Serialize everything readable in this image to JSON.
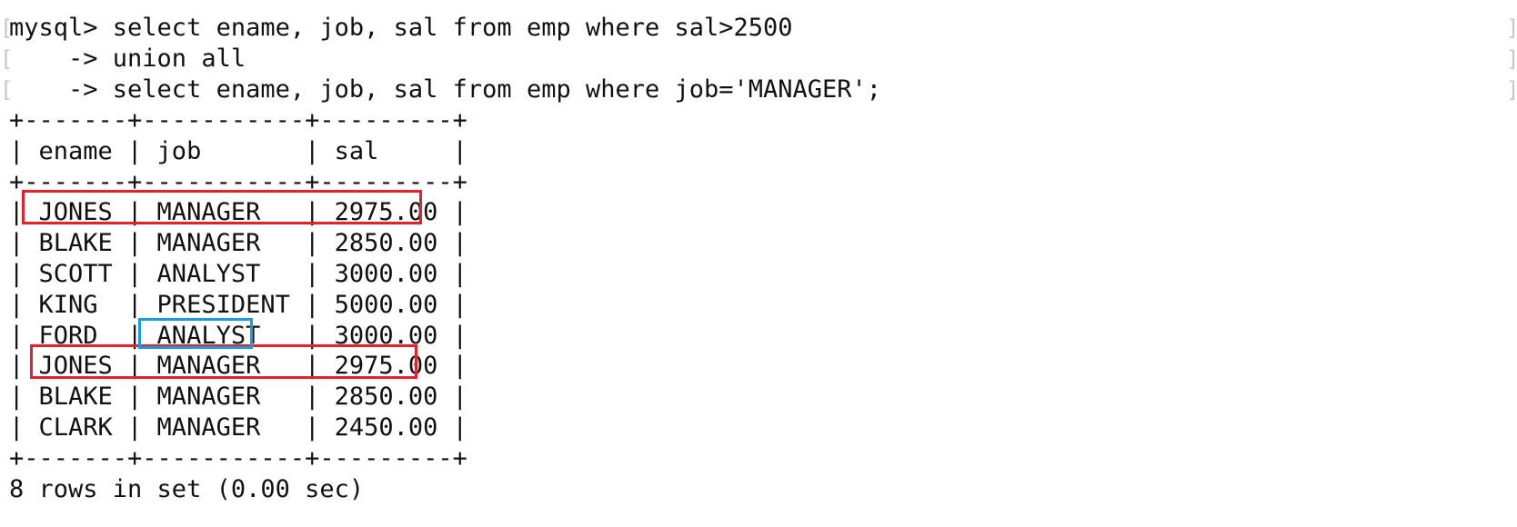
{
  "terminal": {
    "prompt_lines": [
      "mysql> select ename, job, sal from emp where sal>2500",
      "    -> union all",
      "    -> select ename, job, sal from emp where job='MANAGER';"
    ],
    "bracket_left": "[",
    "bracket_right": "]",
    "table": {
      "border": "+-------+-----------+---------+",
      "header": "| ename | job       | sal     |",
      "rows": [
        "| JONES | MANAGER   | 2975.00 |",
        "| BLAKE | MANAGER   | 2850.00 |",
        "| SCOTT | ANALYST   | 3000.00 |",
        "| KING  | PRESIDENT | 5000.00 |",
        "| FORD  | ANALYST   | 3000.00 |",
        "| JONES | MANAGER   | 2975.00 |",
        "| BLAKE | MANAGER   | 2850.00 |",
        "| CLARK | MANAGER   | 2450.00 |"
      ]
    },
    "result_summary": "8 rows in set (0.00 sec)"
  },
  "colors": {
    "highlight_duplicate": "#e8202a",
    "highlight_cell": "#1a9be0",
    "text": "#111111",
    "bracket": "#c8c8c8"
  }
}
